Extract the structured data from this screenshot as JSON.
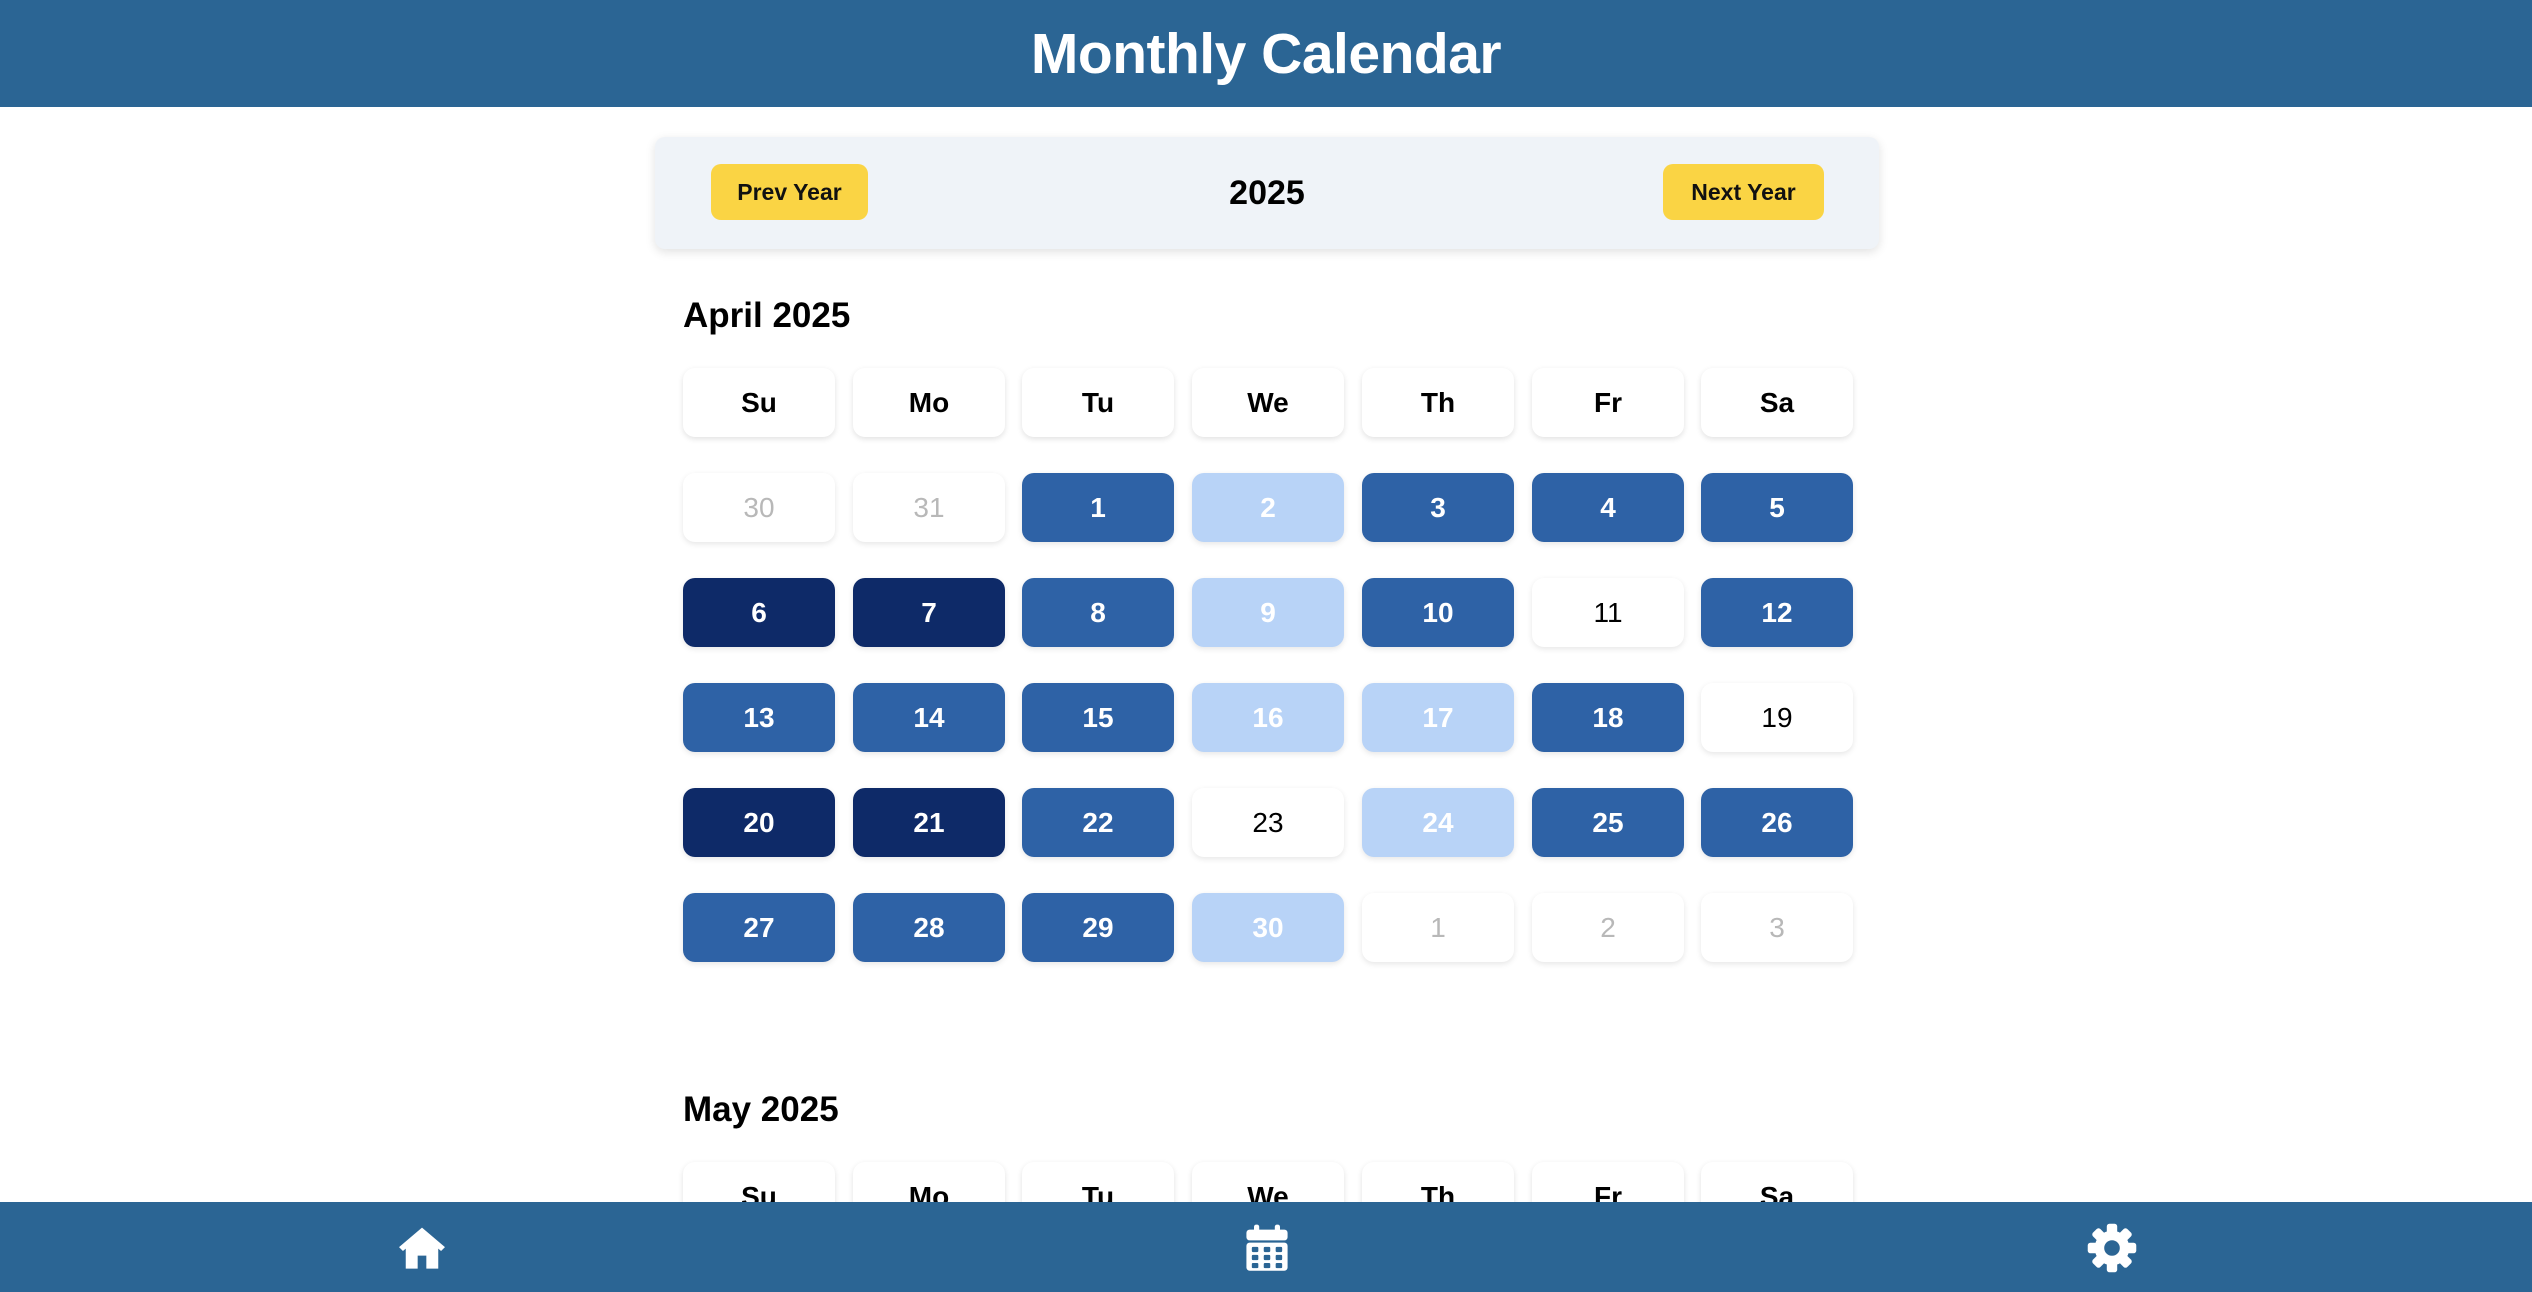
{
  "header": {
    "title": "Monthly Calendar"
  },
  "year_nav": {
    "prev_label": "Prev Year",
    "year": "2025",
    "next_label": "Next Year"
  },
  "weekdays": [
    "Su",
    "Mo",
    "Tu",
    "We",
    "Th",
    "Fr",
    "Sa"
  ],
  "colors": {
    "header_bg": "#2b6594",
    "year_button": "#fad444",
    "level_dark": "#0e2a68",
    "level_medium": "#2e62a6",
    "level_light": "#b8d3f7",
    "outside_text": "#b8b8b8"
  },
  "months": [
    {
      "title": "April 2025",
      "weeks": [
        [
          {
            "d": "30",
            "s": "outside"
          },
          {
            "d": "31",
            "s": "outside"
          },
          {
            "d": "1",
            "s": "medium"
          },
          {
            "d": "2",
            "s": "light"
          },
          {
            "d": "3",
            "s": "medium"
          },
          {
            "d": "4",
            "s": "medium"
          },
          {
            "d": "5",
            "s": "medium"
          }
        ],
        [
          {
            "d": "6",
            "s": "dark"
          },
          {
            "d": "7",
            "s": "dark"
          },
          {
            "d": "8",
            "s": "medium"
          },
          {
            "d": "9",
            "s": "light"
          },
          {
            "d": "10",
            "s": "medium"
          },
          {
            "d": "11",
            "s": "plain"
          },
          {
            "d": "12",
            "s": "medium"
          }
        ],
        [
          {
            "d": "13",
            "s": "medium"
          },
          {
            "d": "14",
            "s": "medium"
          },
          {
            "d": "15",
            "s": "medium"
          },
          {
            "d": "16",
            "s": "light"
          },
          {
            "d": "17",
            "s": "light"
          },
          {
            "d": "18",
            "s": "medium"
          },
          {
            "d": "19",
            "s": "plain"
          }
        ],
        [
          {
            "d": "20",
            "s": "dark"
          },
          {
            "d": "21",
            "s": "dark"
          },
          {
            "d": "22",
            "s": "medium"
          },
          {
            "d": "23",
            "s": "plain"
          },
          {
            "d": "24",
            "s": "light"
          },
          {
            "d": "25",
            "s": "medium"
          },
          {
            "d": "26",
            "s": "medium"
          }
        ],
        [
          {
            "d": "27",
            "s": "medium"
          },
          {
            "d": "28",
            "s": "medium"
          },
          {
            "d": "29",
            "s": "medium"
          },
          {
            "d": "30",
            "s": "light"
          },
          {
            "d": "1",
            "s": "outside"
          },
          {
            "d": "2",
            "s": "outside"
          },
          {
            "d": "3",
            "s": "outside"
          }
        ]
      ]
    },
    {
      "title": "May 2025",
      "weeks": []
    }
  ],
  "bottom_nav": [
    {
      "name": "home",
      "icon": "home-icon"
    },
    {
      "name": "calendar",
      "icon": "calendar-icon"
    },
    {
      "name": "settings",
      "icon": "gear-icon"
    }
  ]
}
